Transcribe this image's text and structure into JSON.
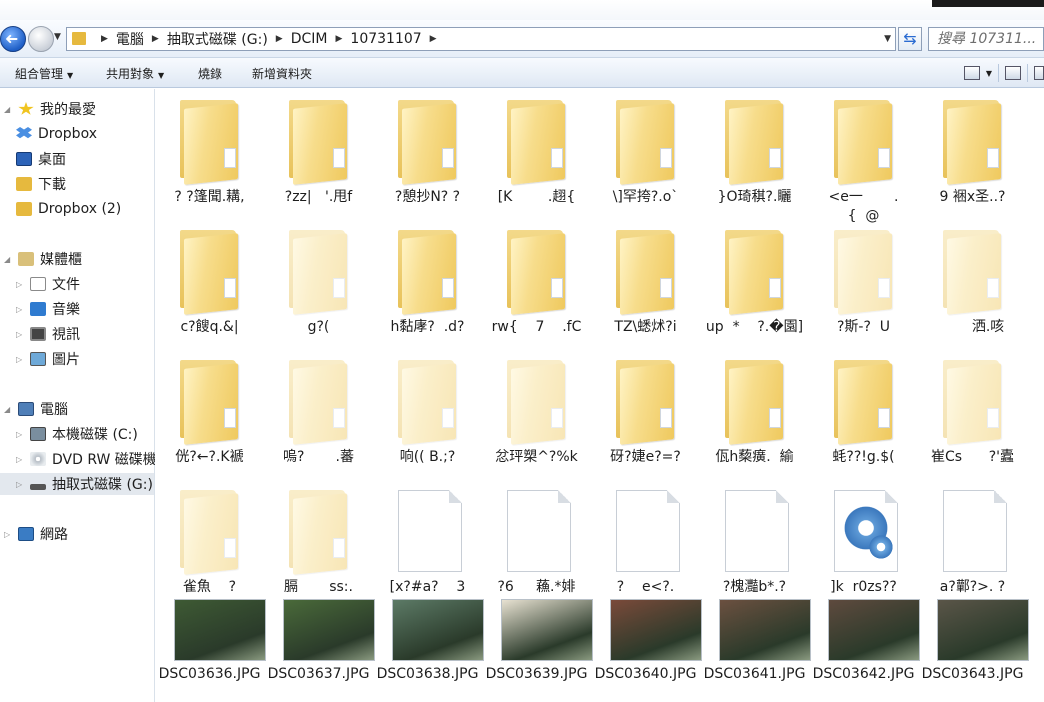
{
  "address": {
    "crumbs": [
      "電腦",
      "抽取式磁碟 (G:)",
      "DCIM",
      "10731107"
    ],
    "search_placeholder": "搜尋 107311..."
  },
  "toolbar": {
    "organize": "組合管理",
    "share": "共用對象",
    "burn": "燒錄",
    "new_folder": "新增資料夾"
  },
  "sidebar": {
    "favorites": "我的最愛",
    "dropbox": "Dropbox",
    "desktop": "桌面",
    "downloads": "下載",
    "dropbox2": "Dropbox (2)",
    "libraries": "媒體櫃",
    "documents": "文件",
    "music": "音樂",
    "videos": "視訊",
    "pictures": "圖片",
    "computer": "電腦",
    "drive_c": "本機磁碟 (C:)",
    "dvd": "DVD RW 磁碟機",
    "drive_g": "抽取式磁碟 (G:)",
    "network": "網路"
  },
  "items": [
    {
      "label": "? ?篷聞.耩,",
      "kind": "folder"
    },
    {
      "label": "?zz|   '.甩f",
      "kind": "folder"
    },
    {
      "label": "?憩抄N? ?",
      "kind": "folder"
    },
    {
      "label": "[K        .趐{",
      "kind": "folder"
    },
    {
      "label": "\\]罕挎?.o`",
      "kind": "folder"
    },
    {
      "label": "}O琦稘?.矖",
      "kind": "folder"
    },
    {
      "label": "<e一       .\n{  @",
      "kind": "folder"
    },
    {
      "label": "9 裍x圣..?",
      "kind": "folder"
    },
    {
      "label": "c?餿q.&|",
      "kind": "folder"
    },
    {
      "label": "g?(",
      "kind": "folder-faded"
    },
    {
      "label": "h黏庨?  .d?",
      "kind": "folder"
    },
    {
      "label": "rw{    7    .fC",
      "kind": "folder"
    },
    {
      "label": "TZ\\蟋炢?i",
      "kind": "folder"
    },
    {
      "label": "up  *    ?.�園]",
      "kind": "folder"
    },
    {
      "label": "?斯-?  U",
      "kind": "folder-faded"
    },
    {
      "label": "       洒.咳",
      "kind": "folder-faded"
    },
    {
      "label": "侊?←?.K褫",
      "kind": "folder"
    },
    {
      "label": "嗚?       .蕃",
      "kind": "folder-faded"
    },
    {
      "label": "响(( B.;?",
      "kind": "folder-faded"
    },
    {
      "label": "忿玶槊^?%k",
      "kind": "folder-faded"
    },
    {
      "label": "砑?婕e?=?",
      "kind": "folder"
    },
    {
      "label": "佤h蔾癀.  緰",
      "kind": "folder"
    },
    {
      "label": "蚝??!g.$(",
      "kind": "folder"
    },
    {
      "label": "崔Cs      ?'蠹",
      "kind": "folder-faded"
    },
    {
      "label": "雀魚    ?",
      "kind": "folder-faded"
    },
    {
      "label": "膈       ss:.",
      "kind": "folder-faded"
    },
    {
      "label": "[x?#a?    3",
      "kind": "doc"
    },
    {
      "label": "?6     蘓.*婔",
      "kind": "doc"
    },
    {
      "label": "?    e<?.",
      "kind": "doc"
    },
    {
      "label": "?槐灩b*.?",
      "kind": "doc"
    },
    {
      "label": "]k  r0zs??",
      "kind": "app"
    },
    {
      "label": "a?鄿?>. ?",
      "kind": "doc"
    },
    {
      "label": "DSC03636.JPG",
      "kind": "photo"
    },
    {
      "label": "DSC03637.JPG",
      "kind": "photo"
    },
    {
      "label": "DSC03638.JPG",
      "kind": "photo"
    },
    {
      "label": "DSC03639.JPG",
      "kind": "photo"
    },
    {
      "label": "DSC03640.JPG",
      "kind": "photo"
    },
    {
      "label": "DSC03641.JPG",
      "kind": "photo"
    },
    {
      "label": "DSC03642.JPG",
      "kind": "photo"
    },
    {
      "label": "DSC03643.JPG",
      "kind": "photo"
    }
  ]
}
